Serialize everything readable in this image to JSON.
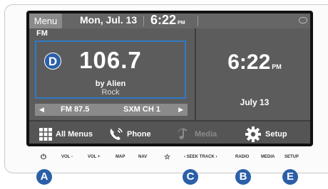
{
  "status_bar": {
    "menu_label": "Menu",
    "date": "Mon, Jul. 13",
    "time": "6:22",
    "ampm": "PM"
  },
  "radio": {
    "source": "FM",
    "frequency": "106.7",
    "artist": "by Alien",
    "genre": "Rock",
    "preset_left": "FM 87.5",
    "preset_right": "SXM CH 1"
  },
  "clock_panel": {
    "time": "6:22",
    "ampm": "PM",
    "date": "July 13"
  },
  "bottom_menu": {
    "all_menus": "All Menus",
    "phone": "Phone",
    "media": "Media",
    "setup": "Setup"
  },
  "hardware_buttons": {
    "power": "⏻",
    "vol_down": "VOL -",
    "vol_up": "VOL +",
    "map": "MAP",
    "nav": "NAV",
    "favorite": "☆",
    "seek_track": "‹ SEEK  TRACK ›",
    "radio": "RADIO",
    "media": "MEDIA",
    "setup": "SETUP"
  },
  "callouts": {
    "a": "A",
    "b": "B",
    "c": "C",
    "d": "D",
    "e": "E"
  },
  "colors": {
    "screen_bg": "#5c5c5c",
    "highlight_border": "#2e79c6",
    "callout_blue": "#2b5fa8"
  }
}
